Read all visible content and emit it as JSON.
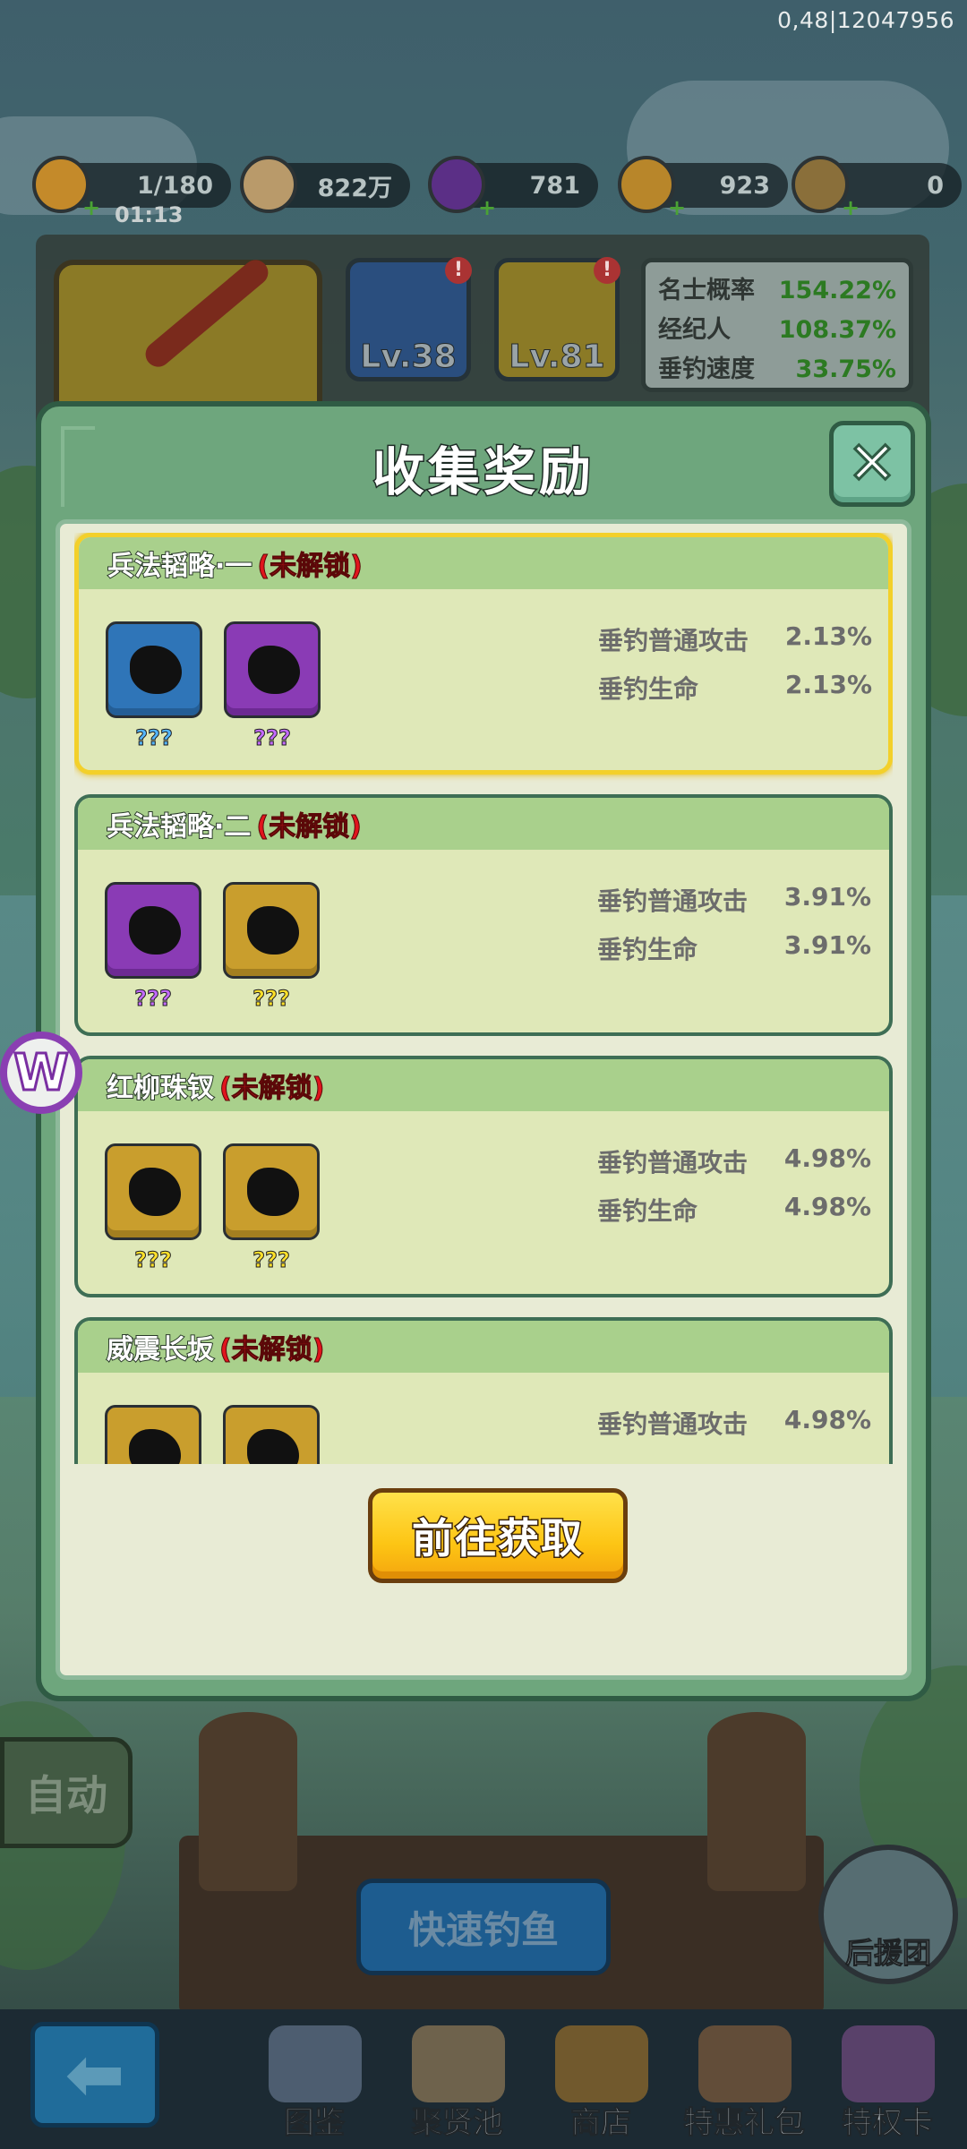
{
  "debug_text": "0,48|12047956",
  "resources": {
    "stamina": {
      "value": "1/180",
      "timer": "01:13",
      "icon": "noodle-bowl-icon"
    },
    "coins": {
      "value": "822万",
      "icon": "coin-icon"
    },
    "gems": {
      "value": "781",
      "icon": "purple-gem-icon"
    },
    "tokens": {
      "value": "923",
      "icon": "token-icon"
    },
    "swords": {
      "value": "0",
      "icon": "sword-icon"
    }
  },
  "upper_panel": {
    "rod_level": "Lv.38",
    "bait_level": "Lv.81",
    "stats": [
      {
        "label": "名士概率",
        "value": "154.22%"
      },
      {
        "label": "经纪人",
        "value": "108.37%"
      },
      {
        "label": "垂钓速度",
        "value": "33.75%"
      }
    ]
  },
  "dialog": {
    "title": "收集奖励",
    "close_icon": "close-x-icon",
    "cards": [
      {
        "name": "兵法韬略·一",
        "status": "(未解锁)",
        "items": [
          {
            "color": "blue",
            "label": "???"
          },
          {
            "color": "purple",
            "label": "???"
          }
        ],
        "stats": [
          {
            "label": "垂钓普通攻击",
            "value": "2.13%"
          },
          {
            "label": "垂钓生命",
            "value": "2.13%"
          }
        ]
      },
      {
        "name": "兵法韬略·二",
        "status": "(未解锁)",
        "items": [
          {
            "color": "purple",
            "label": "???"
          },
          {
            "color": "gold",
            "label": "???"
          }
        ],
        "stats": [
          {
            "label": "垂钓普通攻击",
            "value": "3.91%"
          },
          {
            "label": "垂钓生命",
            "value": "3.91%"
          }
        ]
      },
      {
        "name": "红柳珠钗",
        "status": "(未解锁)",
        "items": [
          {
            "color": "gold",
            "label": "???"
          },
          {
            "color": "gold",
            "label": "???"
          }
        ],
        "stats": [
          {
            "label": "垂钓普通攻击",
            "value": "4.98%"
          },
          {
            "label": "垂钓生命",
            "value": "4.98%"
          }
        ]
      },
      {
        "name": "威震长坂",
        "status": "(未解锁)",
        "items": [
          {
            "color": "gold",
            "label": "???"
          },
          {
            "color": "gold",
            "label": "???"
          }
        ],
        "stats": [
          {
            "label": "垂钓普通攻击",
            "value": "4.98%"
          }
        ]
      }
    ],
    "go_button": "前往获取"
  },
  "side_badge": "W",
  "auto_button": "自动",
  "quick_fish_button": "快速钓鱼",
  "support_label": "后援团",
  "back_icon": "back-arrow-icon",
  "nav": [
    {
      "label": "图鉴",
      "icon": "book-icon"
    },
    {
      "label": "聚贤池",
      "icon": "scroll-icon"
    },
    {
      "label": "商店",
      "icon": "shop-basket-icon"
    },
    {
      "label": "特惠礼包",
      "icon": "gift-pack-icon"
    },
    {
      "label": "特权卡",
      "icon": "privilege-card-icon"
    }
  ],
  "colors": {
    "dialog_green": "#6ea67d",
    "card_header": "#a9d08c",
    "locked_red": "#e0151d",
    "selected_border": "#f3d02a",
    "go_button_yellow": "#fdc514"
  }
}
